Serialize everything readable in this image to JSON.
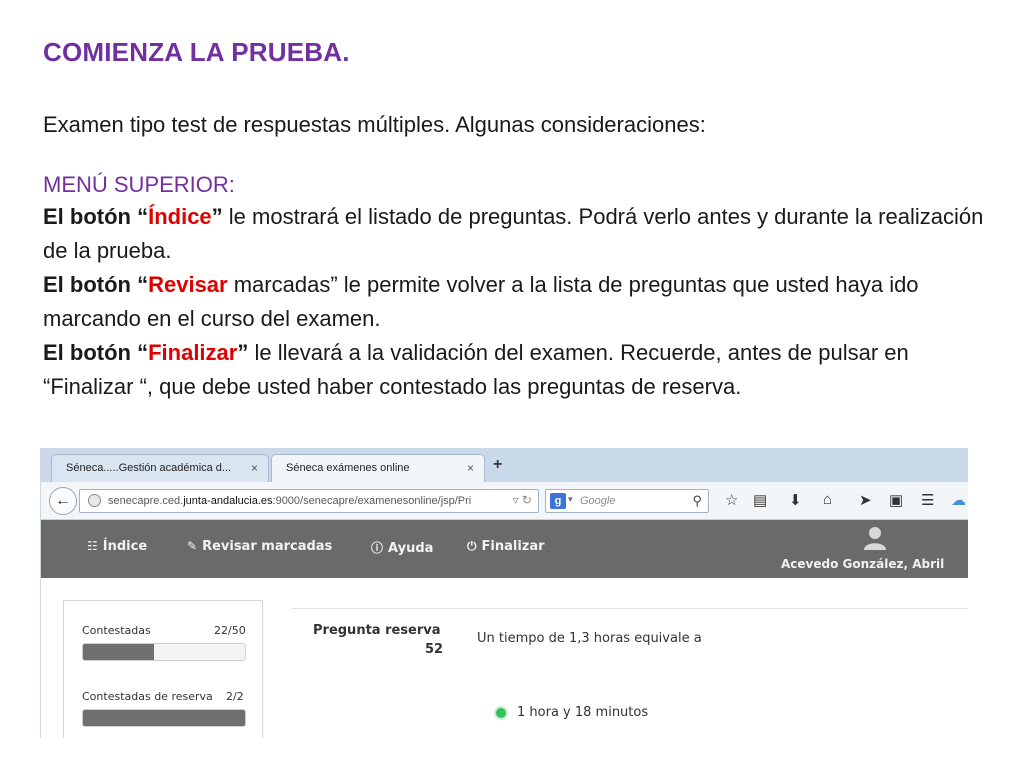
{
  "slide": {
    "title": "COMIENZA LA PRUEBA.",
    "intro": "Examen tipo test de respuestas múltiples. Algunas  consideraciones:",
    "menu_heading": "MENÚ SUPERIOR:",
    "p1_prefix": "El botón “",
    "p1_key": "Índice",
    "p1_suffix": "”",
    "p1_rest": " le mostrará el listado de preguntas. Podrá verlo antes y durante la realización de la prueba.",
    "p2_prefix": "El botón “",
    "p2_key": "Revisar",
    "p2_rest": " marcadas” le permite volver a la lista de preguntas que usted haya ido marcando en el curso del examen.",
    "p3_prefix": "El botón “",
    "p3_key": "Finalizar",
    "p3_suffix": "”",
    "p3_rest": " le llevará a la validación del examen. Recuerde, antes de pulsar en “Finalizar “, que debe usted haber contestado las preguntas de reserva."
  },
  "browser": {
    "tabs": [
      {
        "label": "Séneca.....Gestión académica d...",
        "close": "×"
      },
      {
        "label": "Séneca exámenes online",
        "close": "×"
      }
    ],
    "new_tab": "+",
    "url_prefix": "senecapre.ced.",
    "url_domain": "junta-andalucia.es",
    "url_suffix": ":9000/senecapre/examenesonline/jsp/Pri",
    "search_placeholder": "Google"
  },
  "app": {
    "menu": {
      "indice": "Índice",
      "revisar": "Revisar marcadas",
      "ayuda": "Ayuda",
      "finalizar": "Finalizar"
    },
    "user_name": "Acevedo González, Abril",
    "stats": {
      "contestadas_label": "Contestadas",
      "contestadas_count": "22/50",
      "contestadas_fraction": 0.44,
      "reserva_label": "Contestadas de reserva",
      "reserva_count": "2/2",
      "reserva_fraction": 1.0
    },
    "question": {
      "label": "Pregunta reserva",
      "number": "52",
      "text": "Un tiempo de 1,3 horas equivale a",
      "answer": "1 hora y 18 minutos"
    }
  },
  "colors": {
    "accent_purple": "#7030a0",
    "accent_red": "#e00000",
    "app_bar": "#6a6a6a",
    "radio_selected": "#32c25a"
  }
}
